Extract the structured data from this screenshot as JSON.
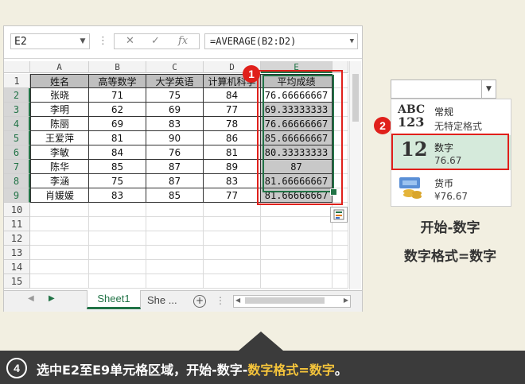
{
  "formula_bar": {
    "name_box": "E2",
    "formula": "=AVERAGE(B2:D2)",
    "cancel_icon": "✕",
    "confirm_icon": "✓",
    "fx_label": "fx"
  },
  "columns": [
    "A",
    "B",
    "C",
    "D",
    "E"
  ],
  "rows": [
    "1",
    "2",
    "3",
    "4",
    "5",
    "6",
    "7",
    "8",
    "9",
    "10",
    "11",
    "12",
    "13",
    "14",
    "15"
  ],
  "table": {
    "headers": [
      "姓名",
      "高等数学",
      "大学英语",
      "计算机科学",
      "平均成绩"
    ],
    "data": [
      [
        "张晓",
        "71",
        "75",
        "84",
        "76.66666667"
      ],
      [
        "李明",
        "62",
        "69",
        "77",
        "69.33333333"
      ],
      [
        "陈丽",
        "69",
        "83",
        "78",
        "76.66666667"
      ],
      [
        "王爱萍",
        "81",
        "90",
        "86",
        "85.66666667"
      ],
      [
        "李敏",
        "84",
        "76",
        "81",
        "80.33333333"
      ],
      [
        "陈华",
        "85",
        "87",
        "89",
        "87"
      ],
      [
        "李涵",
        "75",
        "87",
        "83",
        "81.66666667"
      ],
      [
        "肖媛媛",
        "83",
        "85",
        "77",
        "81.66666667"
      ]
    ]
  },
  "sheet_tabs": {
    "active": "Sheet1",
    "next": "She ...",
    "add": "+"
  },
  "badges": {
    "b1": "1",
    "b2": "2"
  },
  "number_format_panel": {
    "items": [
      {
        "icon_text": "ABC\n123",
        "name": "常规",
        "sample": "无特定格式"
      },
      {
        "icon_text": "12",
        "name": "数字",
        "sample": "76.67"
      },
      {
        "icon_text": "coins",
        "name": "货币",
        "sample": "¥76.67"
      }
    ]
  },
  "annotations": {
    "line1": "开始-数字",
    "line2": "数字格式=数字"
  },
  "caption": {
    "number": "4",
    "prefix": "选中E2至E9单元格区域，开始-数字-",
    "highlight": "数字格式=数字",
    "suffix": "。"
  },
  "colors": {
    "excel_green": "#217346",
    "red_accent": "#e0201b",
    "caption_bg": "#3b3b3b",
    "highlight": "#f6c53b"
  }
}
